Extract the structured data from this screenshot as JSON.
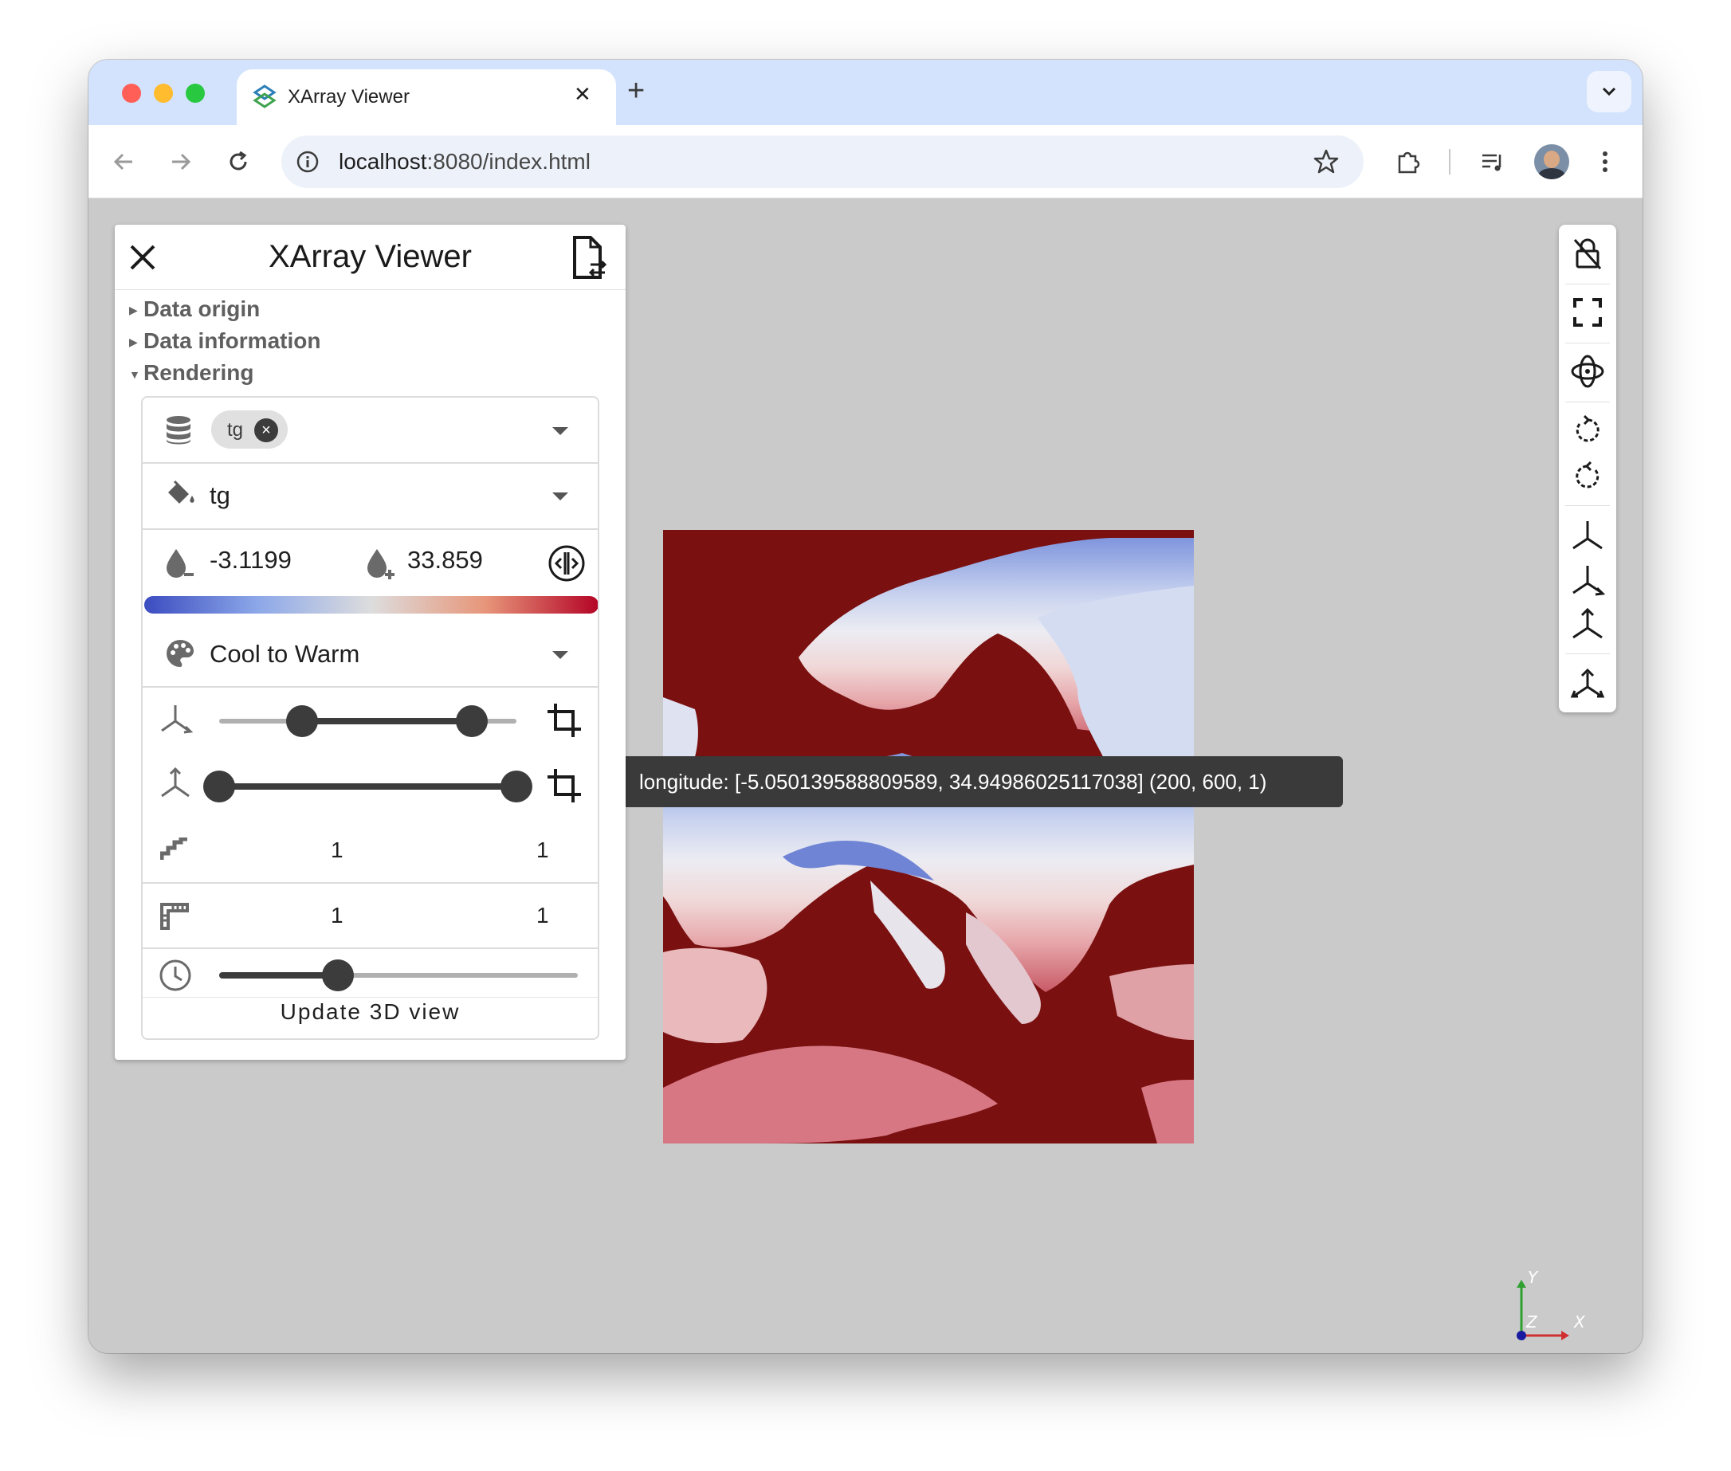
{
  "browser": {
    "tab_title": "XArray Viewer",
    "tab_close": "✕",
    "new_tab": "+",
    "url_host": "localhost",
    "url_rest": ":8080/index.html"
  },
  "panel": {
    "title": "XArray Viewer",
    "sections": [
      {
        "label": "Data origin",
        "expanded": false
      },
      {
        "label": "Data information",
        "expanded": false
      },
      {
        "label": "Rendering",
        "expanded": true
      }
    ],
    "fields_chip": "tg",
    "color_by": "tg",
    "range_min": "-3.1199",
    "range_max": "33.859",
    "colormap": "Cool to Warm",
    "slice_x": {
      "lo": 0.28,
      "hi": 0.85
    },
    "slice_y": {
      "lo": 0.0,
      "hi": 1.0
    },
    "stride": [
      "1",
      "1"
    ],
    "scale": [
      "1",
      "1"
    ],
    "time_fraction": 0.33,
    "update_label": "Update 3D view"
  },
  "viewport": {
    "tooltip": "longitude: [-5.050139588809589, 34.94986025117038] (200, 600, 1)",
    "axis_labels": {
      "x": "X",
      "y": "Y",
      "z": "Z"
    },
    "ocean_color": "#7a1010"
  },
  "colors": {
    "cool": "#3b4cc0",
    "neutral": "#dddddd",
    "warm": "#b40426"
  }
}
